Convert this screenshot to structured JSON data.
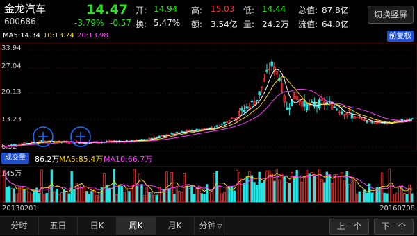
{
  "stock": {
    "name": "金龙汽车",
    "code": "600686",
    "price": "14.47",
    "change_pct": "-3.79%",
    "change": "-0.57"
  },
  "stats": {
    "open_label": "开:",
    "open": "14.94",
    "high_label": "高:",
    "high": "15.03",
    "low_label": "低:",
    "low": "14.44",
    "total_label": "总值:",
    "total": "87.8亿",
    "turnover_label": "换:",
    "turnover": "5.47%",
    "amount_label": "额:",
    "amount": "3.54亿",
    "volume_label": "量:",
    "volume": "24.2万",
    "float_label": "流值:",
    "float": "64.0亿"
  },
  "toggle_label": "切换竖屏",
  "fq_label": "前复权",
  "ma": {
    "ma5": "MA5:14.34",
    "ma10": "10:13.74",
    "ma20": "20:13.98"
  },
  "price_axis": [
    "33.94",
    "27.04",
    "20.13",
    "13.23",
    "6.32"
  ],
  "volume_bar": {
    "button": "成交量",
    "value": "86.2万",
    "ma5": "MA5:85.4万",
    "ma10": "MA10:66.7万",
    "max": "145万"
  },
  "dates": {
    "start": "20130201",
    "end": "20160708"
  },
  "tabs": [
    "分时",
    "五日",
    "日K",
    "周K",
    "月K",
    "分钟"
  ],
  "active_tab": "周K",
  "nav": {
    "prev": "上一个",
    "next": "下一个"
  },
  "colors": {
    "up": "#ff3232",
    "down": "#27e6e6",
    "ma5": "#ffffff",
    "ma10": "#ffd800",
    "ma20": "#ff3cff",
    "accent": "#1d4fd8",
    "drop_green": "#27e61e"
  }
}
